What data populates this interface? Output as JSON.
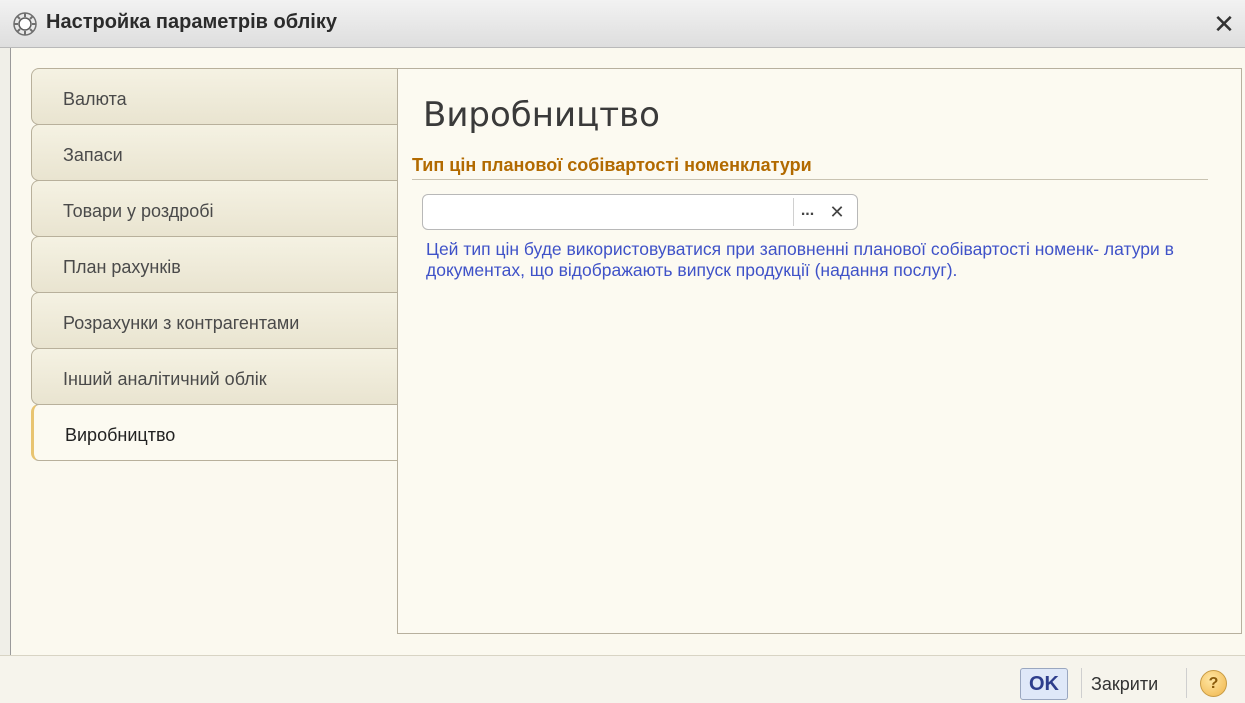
{
  "window": {
    "title": "Настройка параметрів обліку",
    "close_label": "✕"
  },
  "tabs": [
    {
      "label": "Валюта",
      "active": false
    },
    {
      "label": "Запаси",
      "active": false
    },
    {
      "label": "Товари у роздробі",
      "active": false
    },
    {
      "label": "План рахунків",
      "active": false
    },
    {
      "label": "Розрахунки з контрагентами",
      "active": false
    },
    {
      "label": "Інший аналітичний облік",
      "active": false
    },
    {
      "label": "Виробництво",
      "active": true
    }
  ],
  "content": {
    "title": "Виробництво",
    "group_header": "Тип цін планової собівартості номенклатури",
    "input": {
      "value": "",
      "select_button": "...",
      "clear_button": "✕"
    },
    "hint": "Цей тип цін буде використовуватися при заповненні планової собівартості номенк- латури в документах, що відображають випуск продукції (надання послуг)."
  },
  "footer": {
    "ok_label": "OK",
    "close_label": "Закрити",
    "help_label": "?"
  },
  "colors": {
    "accent_orange": "#b26a00",
    "hint_blue": "#3f52c8",
    "panel_bg": "#fbf9ef"
  }
}
